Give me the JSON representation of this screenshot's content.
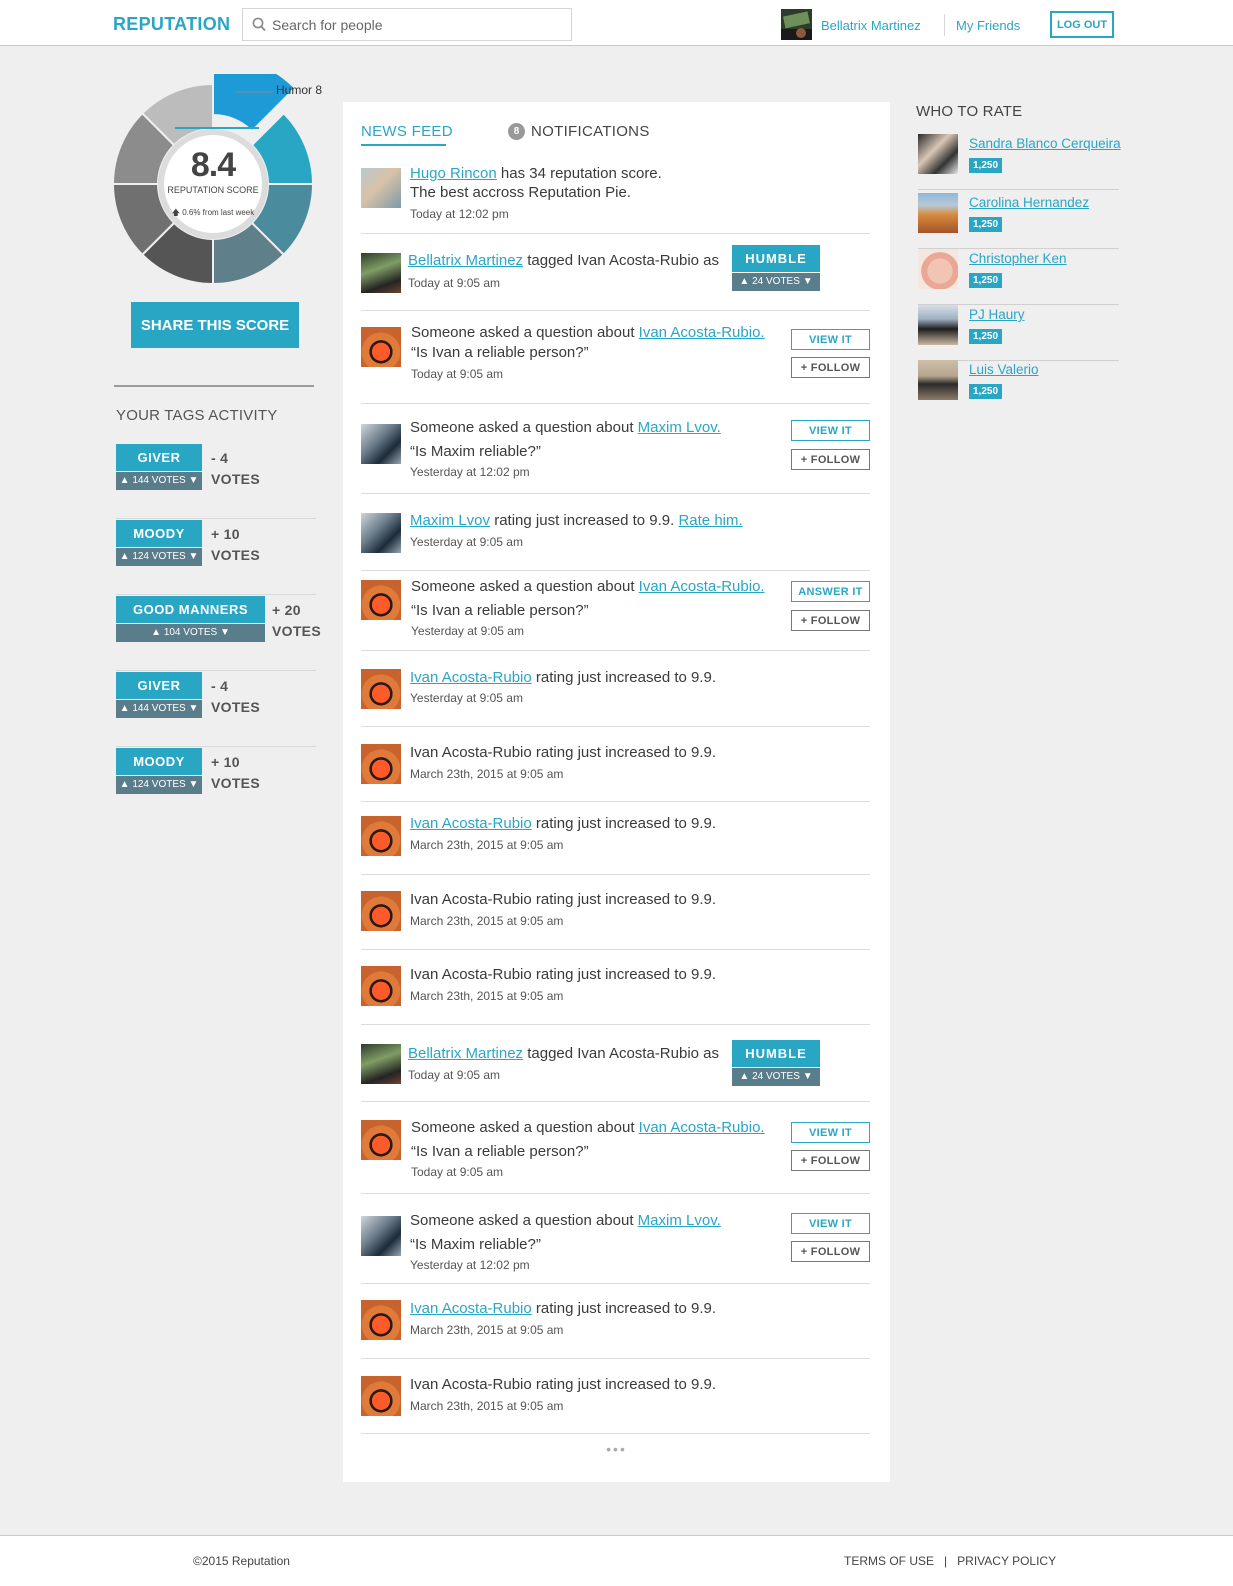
{
  "header": {
    "logo": "REPUTATION",
    "search_placeholder": "Search for people",
    "user_name": "Bellatrix Martinez",
    "friends_link": "My Friends",
    "logout_label": "LOG OUT"
  },
  "score_panel": {
    "highlight_label": "Humor 8",
    "score": "8.4",
    "caption": "REPUTATION SCORE",
    "delta": "0.6% from last week",
    "share_label": "SHARE THIS SCORE",
    "segment_colors": [
      "#1e9bd6",
      "#2aa6c5",
      "#4a8c9e",
      "#5f7f8b",
      "#555555",
      "#707070",
      "#8c8c8c",
      "#bcbcbc"
    ]
  },
  "tags_activity": {
    "title": "YOUR TAGS ACTIVITY",
    "items": [
      {
        "name": "GIVER",
        "votes": "144 VOTES",
        "delta": "- 4",
        "unit": "VOTES"
      },
      {
        "name": "MOODY",
        "votes": "124 VOTES",
        "delta": "+ 10",
        "unit": "VOTES"
      },
      {
        "name": "GOOD MANNERS",
        "votes": "104 VOTES",
        "delta": "+ 20",
        "unit": "VOTES"
      },
      {
        "name": "GIVER",
        "votes": "144 VOTES",
        "delta": "- 4",
        "unit": "VOTES"
      },
      {
        "name": "MOODY",
        "votes": "124 VOTES",
        "delta": "+ 10",
        "unit": "VOTES"
      }
    ]
  },
  "feed": {
    "tab_news": "NEWS FEED",
    "notif_count": "8",
    "tab_notifications": "NOTIFICATIONS",
    "more": "•••",
    "items": [
      {
        "link": "Hugo Rincon",
        "text": " has 34 reputation score.",
        "line2": "The best accross Reputation Pie.",
        "time": "Today at 12:02 pm"
      },
      {
        "link": "Bellatrix Martinez",
        "text": " tagged Ivan Acosta-Rubio as",
        "tag": "HUMBLE",
        "votes": "24 VOTES",
        "time": "Today at 9:05 am"
      },
      {
        "pre": "Someone asked a question about ",
        "link": "Ivan Acosta-Rubio.",
        "line2": "“Is Ivan a reliable person?”",
        "time": "Today at 9:05 am",
        "btn1": "VIEW IT",
        "btn2": "+ FOLLOW"
      },
      {
        "pre": "Someone asked a question about ",
        "link": "Maxim Lvov.",
        "line2": "“Is Maxim reliable?”",
        "time": "Yesterday at 12:02 pm",
        "btn1": "VIEW IT",
        "btn2": "+ FOLLOW"
      },
      {
        "link": "Maxim Lvov",
        "text": " rating just increased to 9.9. ",
        "link2": "Rate him.",
        "time": "Yesterday at 9:05 am"
      },
      {
        "pre": "Someone asked a question about ",
        "link": "Ivan Acosta-Rubio.",
        "line2": "“Is Ivan a reliable person?”",
        "time": "Yesterday at 9:05 am",
        "btn1": "ANSWER IT",
        "btn2": "+ FOLLOW"
      },
      {
        "link": "Ivan Acosta-Rubio",
        "text": " rating just increased to 9.9.",
        "time": "Yesterday at 9:05 am"
      },
      {
        "plain": "Ivan Acosta-Rubio rating just increased to 9.9.",
        "time": "March 23th, 2015 at 9:05 am"
      },
      {
        "link": "Ivan Acosta-Rubio",
        "text": " rating just increased to 9.9.",
        "time": "March 23th, 2015 at 9:05 am"
      },
      {
        "plain": "Ivan Acosta-Rubio rating just increased to 9.9.",
        "time": "March 23th, 2015 at 9:05 am"
      },
      {
        "plain": "Ivan Acosta-Rubio rating just increased to 9.9.",
        "time": "March 23th, 2015 at 9:05 am"
      },
      {
        "link": "Bellatrix Martinez",
        "text": " tagged Ivan Acosta-Rubio as",
        "tag": "HUMBLE",
        "votes": "24 VOTES",
        "time": "Today at 9:05 am"
      },
      {
        "pre": "Someone asked a question about ",
        "link": "Ivan Acosta-Rubio.",
        "line2": "“Is Ivan a reliable person?”",
        "time": "Today at 9:05 am",
        "btn1": "VIEW IT",
        "btn2": "+ FOLLOW"
      },
      {
        "pre": "Someone asked a question about ",
        "link": "Maxim Lvov.",
        "line2": "“Is Maxim reliable?”",
        "time": "Yesterday at 12:02 pm",
        "btn1": "VIEW IT",
        "btn2": "+ FOLLOW"
      },
      {
        "link": "Ivan Acosta-Rubio",
        "text": " rating just increased to 9.9.",
        "time": "March 23th, 2015 at 9:05 am"
      },
      {
        "plain": "Ivan Acosta-Rubio rating just increased to 9.9.",
        "time": "March 23th, 2015 at 9:05 am"
      }
    ]
  },
  "who_to_rate": {
    "title": "WHO TO RATE",
    "people": [
      {
        "name": "Sandra Blanco Cerqueira",
        "score": "1,250"
      },
      {
        "name": "Carolina Hernandez",
        "score": "1,250"
      },
      {
        "name": "Christopher Ken",
        "score": "1,250"
      },
      {
        "name": "PJ Haury",
        "score": "1,250"
      },
      {
        "name": "Luis Valerio",
        "score": "1,250"
      }
    ]
  },
  "footer": {
    "copyright": "©2015 Reputation",
    "terms": "TERMS OF USE",
    "separator": "|",
    "privacy": "PRIVACY POLICY"
  }
}
